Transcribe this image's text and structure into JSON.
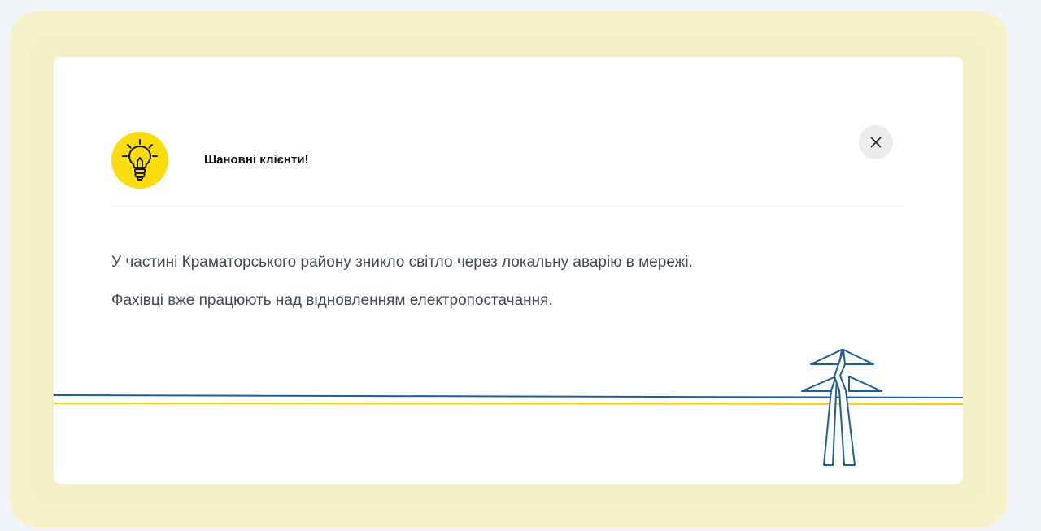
{
  "modal": {
    "title": "Шановні клієнти!",
    "message_1": "У частині Краматорського району зникло світло через локальну аварію в мережі.",
    "message_2": "Фахівці вже працюють над відновленням електропостачання.",
    "icon": "lightbulb-icon",
    "close_icon": "close-icon"
  },
  "colors": {
    "badge": "#fbdc0f",
    "line_blue": "#1f5f98",
    "line_yellow": "#f5d20e",
    "text": "#3f4a55"
  }
}
